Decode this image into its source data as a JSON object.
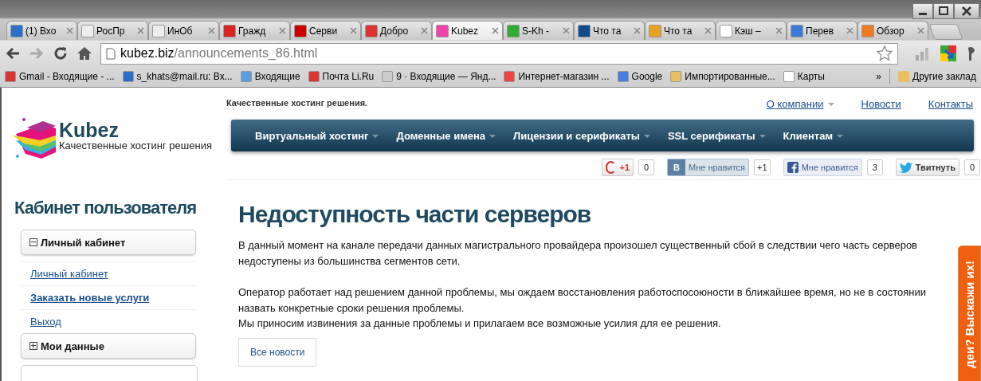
{
  "browser": {
    "tabs": [
      {
        "title": "(1) Вхо",
        "selected": false
      },
      {
        "title": "РосПр",
        "selected": false
      },
      {
        "title": "ИнОб",
        "selected": false
      },
      {
        "title": "Гражд",
        "selected": false
      },
      {
        "title": "Серви",
        "selected": false
      },
      {
        "title": "Добро",
        "selected": false
      },
      {
        "title": "Kubez",
        "selected": true
      },
      {
        "title": "S-Kh -",
        "selected": false
      },
      {
        "title": "Что та",
        "selected": false
      },
      {
        "title": "Что та",
        "selected": false
      },
      {
        "title": "Кэш –",
        "selected": false
      },
      {
        "title": "Перев",
        "selected": false
      },
      {
        "title": "Обзор",
        "selected": false
      }
    ],
    "address": {
      "host": "kubez.biz",
      "path": "/announcements_86.html"
    },
    "bookmarks": [
      "Gmail - Входящие - ...",
      "s_khats@mail.ru: Вх...",
      "Входящие",
      "Почта Li.Ru",
      "9 · Входящие — Янд...",
      "Интернет-магазин ...",
      "Google",
      "Импортированные...",
      "Карты"
    ],
    "bookmarks_more": "»",
    "other_bookmarks": "Другие заклад"
  },
  "site": {
    "logo": {
      "name": "Kubez",
      "slogan": "Качественные хостинг решения"
    },
    "tagline": "Качественные хостинг решения.",
    "top_links": [
      {
        "label": "О компании",
        "has_menu": true
      },
      {
        "label": "Новости",
        "has_menu": false
      },
      {
        "label": "Контакты",
        "has_menu": false
      }
    ],
    "nav": [
      {
        "label": "Виртуальный хостинг",
        "has_menu": true
      },
      {
        "label": "Доменные имена",
        "has_menu": true
      },
      {
        "label": "Лицензии и серификаты",
        "has_menu": true
      },
      {
        "label": "SSL серификаты",
        "has_menu": true
      },
      {
        "label": "Клиентам",
        "has_menu": true
      }
    ],
    "social": [
      {
        "kind": "gplus",
        "label": "+1",
        "count": "0"
      },
      {
        "kind": "vk",
        "label": "Мне нравится",
        "badge": "В",
        "count": "+1"
      },
      {
        "kind": "facebook",
        "label": "Мне нравится",
        "count": "3"
      },
      {
        "kind": "twitter",
        "label": "Твитнуть",
        "count": "0"
      }
    ]
  },
  "sidebar": {
    "title": "Кабинет пользователя",
    "sections": [
      {
        "title": "Личный кабинет",
        "expanded": true,
        "links": [
          {
            "label": "Личный кабинет",
            "selected": false
          },
          {
            "label": "Заказать новые услуги",
            "selected": true
          },
          {
            "label": "Выход",
            "selected": false
          }
        ]
      },
      {
        "title": "Мои данные",
        "expanded": false
      }
    ]
  },
  "article": {
    "title": "Недоступность части серверов",
    "paragraphs": [
      "В данный момент на канале передачи данных магистрального провайдера произошел существенный сбой в следствии чего часть серверов недоступены из большинства сегментов сети.",
      "Оператор работает над решением данной проблемы, мы ождаем восстановления работоспосоюности в ближайшее время, но не в состоянии назвать конкретные сроки решения проблемы.",
      "Мы приносим извинения за данные проблемы и прилагаем все возможные усилия для ее решения."
    ],
    "button": "Все новости"
  },
  "feedback_tab": "деи? Выскажи их!"
}
